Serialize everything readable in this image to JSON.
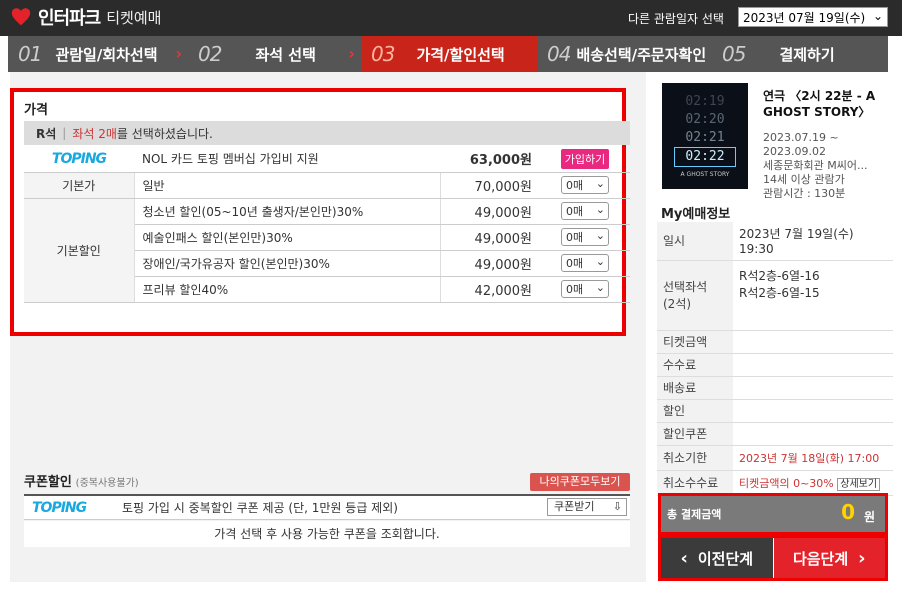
{
  "header": {
    "logo_text": "인터파크",
    "logo_sub": "티켓예매",
    "date_label": "다른 관람일자 선택",
    "date_value": "2023년 07월 19일(수)"
  },
  "steps": [
    {
      "num": "01",
      "label": "관람일/회차선택"
    },
    {
      "num": "02",
      "label": "좌석 선택"
    },
    {
      "num": "03",
      "label": "가격/할인선택"
    },
    {
      "num": "04",
      "label": "배송선택/주문자확인"
    },
    {
      "num": "05",
      "label": "결제하기"
    }
  ],
  "price": {
    "title": "가격",
    "grade": "R석",
    "selected_text": "좌석 2매",
    "selected_suffix": "를 선택하셨습니다.",
    "promo": {
      "brand": "TOPING",
      "label": "NOL 카드 토핑 멤버십 가입비 지원",
      "amount": "63,000원",
      "button": "가입하기"
    },
    "rows": [
      {
        "category": "기본가",
        "label": "일반",
        "amount": "70,000원",
        "qty": "0매"
      },
      {
        "category": "기본할인",
        "label": "청소년 할인(05~10년 출생자/본인만)30%",
        "amount": "49,000원",
        "qty": "0매"
      },
      {
        "category": "",
        "label": "예술인패스 할인(본인만)30%",
        "amount": "49,000원",
        "qty": "0매"
      },
      {
        "category": "",
        "label": "장애인/국가유공자 할인(본인만)30%",
        "amount": "49,000원",
        "qty": "0매"
      },
      {
        "category": "",
        "label": "프리뷰 할인40%",
        "amount": "42,000원",
        "qty": "0매"
      }
    ]
  },
  "coupon": {
    "title": "쿠폰할인",
    "title_note": "(중복사용불가)",
    "all_button": "나의쿠폰모두보기",
    "brand": "TOPING",
    "row_text": "토핑 가입 시 중복할인 쿠폰 제공 (단, 1만원 등급 제외)",
    "recv_button": "쿠폰받기",
    "message": "가격 선택 후 사용 가능한 쿠폰을 조회합니다."
  },
  "performance": {
    "title": "연극 〈2시 22분 - A GHOST STORY〉",
    "period_start": "2023.07.19 ~",
    "period_end": "2023.09.02",
    "venue": "세종문화회관 M씨어...",
    "age": "14세 이상 관람가",
    "runtime": "관람시간 : 130분",
    "poster_lines": [
      "02:19",
      "02:20",
      "02:21",
      "02:22"
    ],
    "poster_caption": "A GHOST STORY"
  },
  "my": {
    "title": "My예매정보",
    "date_k": "일시",
    "date_v1": "2023년 7월 19일(수)",
    "date_v2": "19:30",
    "seat_k1": "선택좌석",
    "seat_k2": "(2석)",
    "seat_v1": "R석2층-6열-16",
    "seat_v2": "R석2층-6열-15",
    "ticket_k": "티켓금액",
    "fee_k": "수수료",
    "delivery_k": "배송료",
    "discount_k": "할인",
    "coupon_k": "할인쿠폰",
    "cancel_k": "취소기한",
    "cancel_v": "2023년 7월 18일(화) 17:00",
    "cancelfee_k": "취소수수료",
    "cancelfee_v": "티켓금액의 0~30%",
    "cancelfee_btn": "상세보기"
  },
  "total": {
    "label": "총 결제금액",
    "amount": "0",
    "unit": "원"
  },
  "nav": {
    "prev": "이전단계",
    "next": "다음단계"
  }
}
